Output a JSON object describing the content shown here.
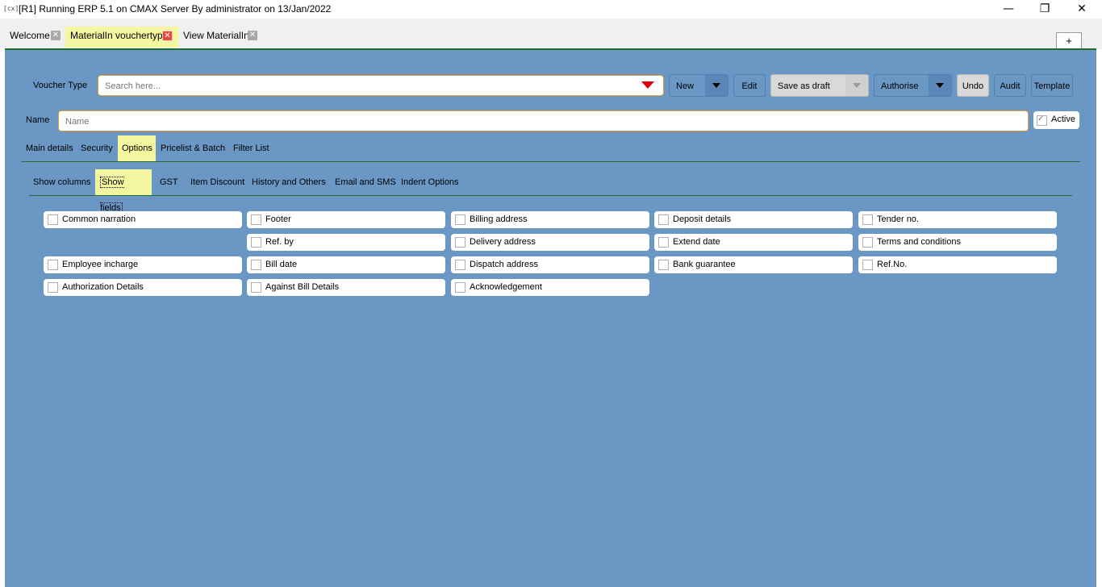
{
  "window": {
    "icon_label": "[cx]",
    "title": "[R1] Running ERP 5.1 on CMAX Server By administrator on 13/Jan/2022",
    "minimize_glyph": "—",
    "restore_glyph": "❐",
    "close_glyph": "✕"
  },
  "tabs": [
    {
      "label": "Welcome",
      "active": false
    },
    {
      "label": "MaterialIn vouchertype",
      "active": true
    },
    {
      "label": "View MaterialIn",
      "active": false
    }
  ],
  "tab_close_glyph": "✕",
  "add_tab_label": "+",
  "toolbar": {
    "voucher_type_label": "Voucher Type",
    "search_placeholder": "Search here...",
    "new_label": "New",
    "edit_label": "Edit",
    "save_draft_label": "Save as draft",
    "authorise_label": "Authorise",
    "undo_label": "Undo",
    "audit_label": "Audit",
    "template_label": "Template"
  },
  "name_row": {
    "label": "Name",
    "placeholder": "Name",
    "active_label": "Active",
    "active_checked": true
  },
  "section_tabs": [
    {
      "label": "Main details",
      "selected": false
    },
    {
      "label": "Security",
      "selected": false
    },
    {
      "label": "Options",
      "selected": true
    },
    {
      "label": "Pricelist & Batch",
      "selected": false
    },
    {
      "label": "Filter List",
      "selected": false
    }
  ],
  "option_tabs": [
    {
      "label": "Show columns",
      "selected": false
    },
    {
      "label": "Show fields",
      "selected": true
    },
    {
      "label": "GST",
      "selected": false
    },
    {
      "label": "Item Discount",
      "selected": false
    },
    {
      "label": "History and Others",
      "selected": false
    },
    {
      "label": "Email and SMS",
      "selected": false
    },
    {
      "label": "Indent Options",
      "selected": false
    }
  ],
  "fields": {
    "common_narration": "Common narration",
    "footer": "Footer",
    "billing_address": "Billing address",
    "deposit_details": "Deposit details",
    "tender_no": "Tender no.",
    "ref_by": "Ref. by",
    "delivery_address": "Delivery address",
    "extend_date": "Extend date",
    "terms_and_conditions": "Terms and conditions",
    "employee_incharge": "Employee incharge",
    "bill_date": "Bill date",
    "dispatch_address": "Dispatch address",
    "bank_guarantee": "Bank guarantee",
    "ref_no": "Ref.No.",
    "authorization_details": "Authorization Details",
    "against_bill_details": "Against Bill Details",
    "acknowledgement": "Acknowledgement"
  },
  "colors": {
    "panel_bg": "#6b97c5",
    "highlight": "#f4f6a0",
    "accent_border": "#e0a030",
    "rule_green": "#1f6e2e",
    "dropdown_arrow": "#e00000"
  }
}
